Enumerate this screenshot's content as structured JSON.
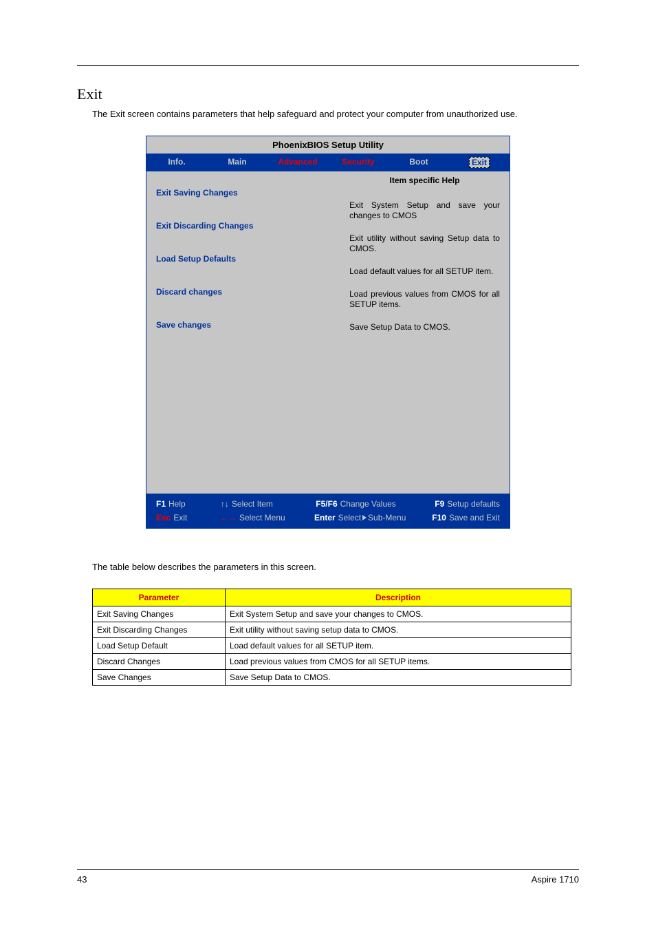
{
  "page": {
    "section_title": "Exit",
    "intro": "The Exit screen contains parameters that help safeguard and protect your computer from unauthorized use.",
    "table_caption": "The table below describes the parameters in this screen.",
    "page_number": "43",
    "product": "Aspire 1710"
  },
  "bios": {
    "title": "PhoenixBIOS Setup Utility",
    "tabs": [
      "Info.",
      "Main",
      "Advanced",
      "Security",
      "Boot",
      "Exit"
    ],
    "help_title": "Item specific Help",
    "items": [
      {
        "label": "Exit Saving Changes",
        "help": "Exit System Setup and save your changes to CMOS"
      },
      {
        "label": "Exit Discarding Changes",
        "help": "Exit utility without saving Setup data to CMOS."
      },
      {
        "label": "Load Setup Defaults",
        "help": "Load default values for all SETUP item."
      },
      {
        "label": "Discard changes",
        "help": "Load previous values from CMOS for all SETUP items."
      },
      {
        "label": "Save changes",
        "help": "Save Setup Data to CMOS."
      }
    ],
    "footer": {
      "row1": {
        "c1_key": "F1",
        "c1_label": "Help",
        "c2_arrow": "↑↓",
        "c2_label": "Select Item",
        "c3_key": "F5/F6",
        "c3_label": "Change Values",
        "c4_key": "F9",
        "c4_label": "Setup defaults"
      },
      "row2": {
        "c1_key": "Esc",
        "c1_label": "Exit",
        "c2_arrow": "←→",
        "c2_label": "Select Menu",
        "c3_key": "Enter",
        "c3_label_a": "Select",
        "c3_label_b": "Sub-Menu",
        "c4_key": "F10",
        "c4_label": "Save and Exit"
      }
    }
  },
  "table": {
    "headers": [
      "Parameter",
      "Description"
    ],
    "rows": [
      [
        "Exit Saving Changes",
        "Exit System Setup and save your changes to CMOS."
      ],
      [
        "Exit Discarding Changes",
        "Exit utility without saving setup data to CMOS."
      ],
      [
        "Load Setup Default",
        "Load default values for all SETUP item."
      ],
      [
        "Discard Changes",
        "Load previous values from CMOS for all SETUP items."
      ],
      [
        "Save Changes",
        "Save Setup Data to CMOS."
      ]
    ]
  }
}
